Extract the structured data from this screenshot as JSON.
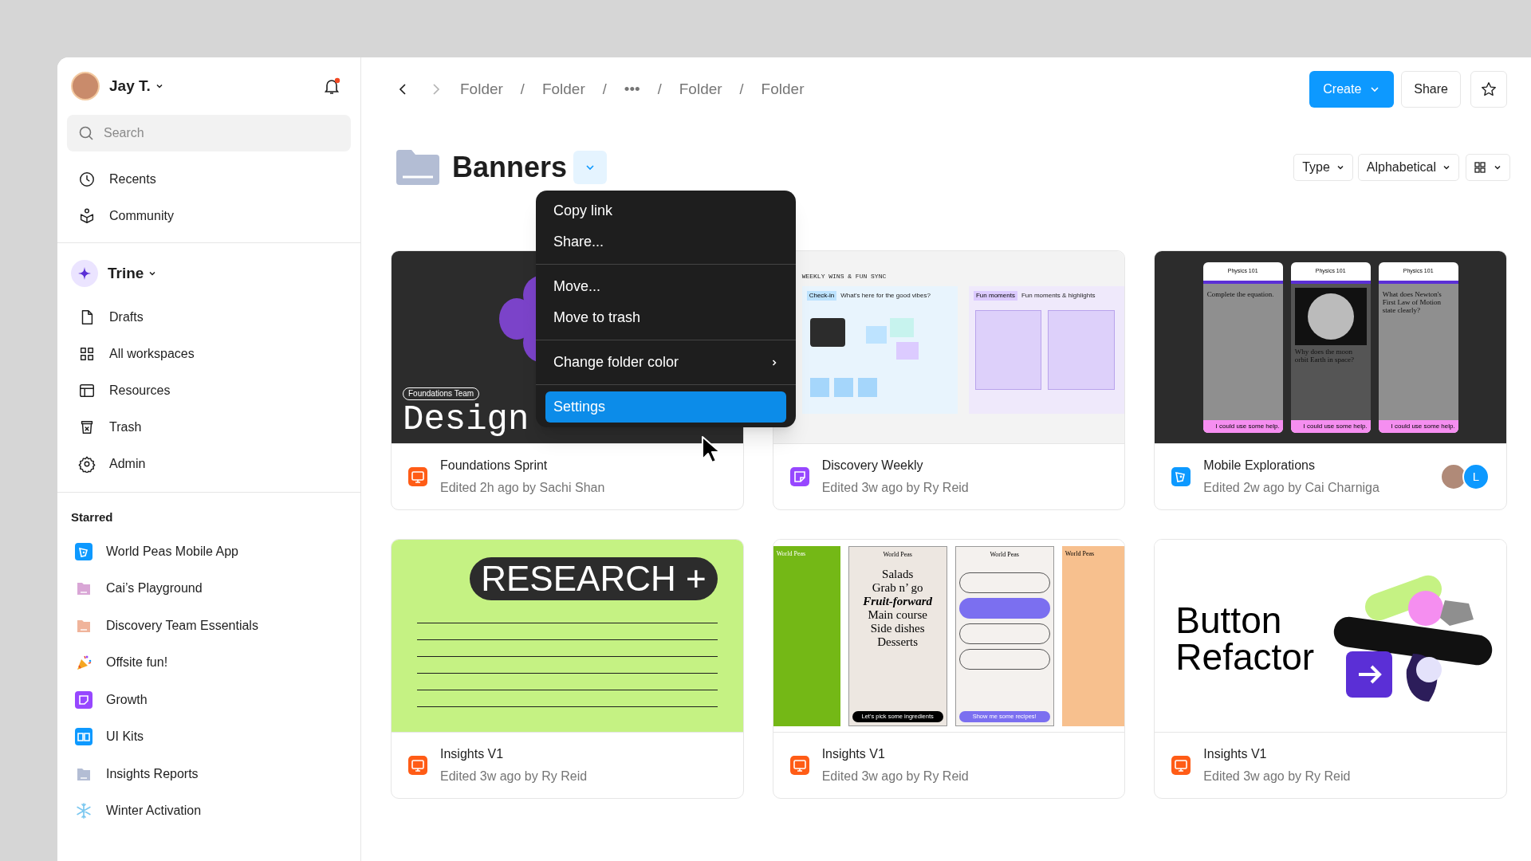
{
  "sidebar": {
    "user": {
      "name": "Jay T."
    },
    "notifications": {
      "unread": true
    },
    "search": {
      "placeholder": "Search"
    },
    "nav": [
      {
        "label": "Recents"
      },
      {
        "label": "Community"
      }
    ],
    "workspace": {
      "name": "Trine"
    },
    "workspace_nav": [
      {
        "label": "Drafts"
      },
      {
        "label": "All workspaces"
      },
      {
        "label": "Resources"
      },
      {
        "label": "Trash"
      },
      {
        "label": "Admin"
      }
    ],
    "starred": {
      "heading": "Starred",
      "items": [
        {
          "label": "World Peas Mobile App",
          "kind": "prototype",
          "color": "#0d99ff"
        },
        {
          "label": "Cai’s Playground",
          "kind": "folder",
          "color": "#d9a6d6"
        },
        {
          "label": "Discovery Team Essentials",
          "kind": "folder",
          "color": "#f0b49b"
        },
        {
          "label": "Offsite fun!",
          "kind": "party"
        },
        {
          "label": "Growth",
          "kind": "whiteboard",
          "color": "#9747ff"
        },
        {
          "label": "UI Kits",
          "kind": "library",
          "color": "#0d99ff"
        },
        {
          "label": "Insights Reports",
          "kind": "folder",
          "color": "#b3bdd4"
        },
        {
          "label": "Winter Activation",
          "kind": "snowflake"
        }
      ]
    }
  },
  "toolbar": {
    "breadcrumbs": [
      "Folder",
      "Folder",
      "•••",
      "Folder",
      "Folder"
    ],
    "separator": "/",
    "buttons": [
      {
        "label": "Create",
        "kind": "primary"
      },
      {
        "label": "Share",
        "kind": "secondary"
      }
    ]
  },
  "folder": {
    "title": "Banners",
    "menu_open": true,
    "sort": [
      {
        "label": "Type"
      },
      {
        "label": "Alphabetical"
      }
    ]
  },
  "context_menu": {
    "groups": [
      [
        {
          "label": "Copy link",
          "selected": false,
          "submenu": false
        },
        {
          "label": "Share...",
          "selected": false,
          "submenu": false
        }
      ],
      [
        {
          "label": "Move...",
          "selected": false,
          "submenu": false
        },
        {
          "label": "Move to trash",
          "selected": false,
          "submenu": false
        }
      ],
      [
        {
          "label": "Change folder color",
          "selected": false,
          "submenu": true
        }
      ],
      [
        {
          "label": "Settings",
          "selected": true,
          "submenu": false
        }
      ]
    ]
  },
  "files": [
    {
      "title": "Foundations Sprint",
      "meta": "Edited 2h ago by Sachi Shan",
      "kind": "slides",
      "thumbnail": {
        "kind": "design-system",
        "tag": "Foundations Team",
        "heading": "Design"
      }
    },
    {
      "title": "Discovery Weekly",
      "meta": "Edited 3w ago by Ry Reid",
      "kind": "whiteboard",
      "thumbnail": {
        "kind": "whiteboard",
        "heading": "WEEKLY WINS & FUN SYNC",
        "sections": [
          {
            "tag": "Check-in",
            "title": "What's here for the good vibes?"
          },
          {
            "tag": "Fun moments",
            "title": "Fun moments & highlights"
          }
        ]
      }
    },
    {
      "title": "Mobile Explorations",
      "meta": "Edited 2w ago by Cai Charniga",
      "kind": "prototype",
      "collaborators": [
        {
          "kind": "photo"
        },
        {
          "kind": "initial",
          "initial": "L",
          "color": "#0d99ff"
        }
      ],
      "thumbnail": {
        "kind": "phones",
        "screens": [
          {
            "title": "Physics 101",
            "question": "Complete the equation.",
            "footer": "I could use some help."
          },
          {
            "title": "Physics 101",
            "question": "Why does the moon orbit Earth in space?",
            "footer": "I could use some help."
          },
          {
            "title": "Physics 101",
            "question": "What does Newton's First Law of Motion state clearly?",
            "footer": "I could use some help."
          }
        ]
      }
    },
    {
      "title": "Insights V1",
      "meta": "Edited 3w ago by Ry Reid",
      "kind": "slides",
      "thumbnail": {
        "kind": "research",
        "heading": "RESEARCH +"
      }
    },
    {
      "title": "Insights V1",
      "meta": "Edited 3w ago by Ry Reid",
      "kind": "slides",
      "thumbnail": {
        "kind": "recipes",
        "brands": [
          "World Peas",
          "World Peas",
          "World Peas",
          "World Peas"
        ],
        "menu": [
          "Salads",
          "Grab n’ go",
          "Fruit-forward",
          "Main course",
          "Side dishes",
          "Desserts"
        ],
        "buttons": [
          "Let's pick some ingredients",
          "Show me some recipes!"
        ]
      }
    },
    {
      "title": "Insights V1",
      "meta": "Edited 3w ago by Ry Reid",
      "kind": "slides",
      "thumbnail": {
        "kind": "button-refactor",
        "heading": "Button Refactor"
      }
    }
  ]
}
